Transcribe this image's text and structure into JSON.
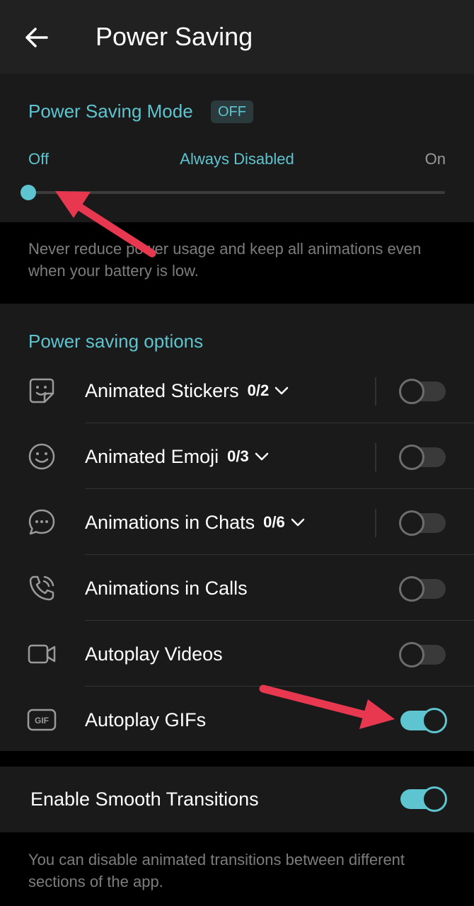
{
  "header": {
    "title": "Power Saving"
  },
  "mode": {
    "title": "Power Saving Mode",
    "badge": "OFF",
    "slider": {
      "left_label": "Off",
      "middle_label": "Always Disabled",
      "right_label": "On",
      "value": 0
    },
    "description": "Never reduce power usage and keep all animations even when your battery is low."
  },
  "options": {
    "title": "Power saving options",
    "items": [
      {
        "label": "Animated Stickers",
        "count": "0/2",
        "icon": "sticker-icon",
        "expandable": true,
        "on": false
      },
      {
        "label": "Animated Emoji",
        "count": "0/3",
        "icon": "emoji-icon",
        "expandable": true,
        "on": false
      },
      {
        "label": "Animations in Chats",
        "count": "0/6",
        "icon": "chat-bubble-icon",
        "expandable": true,
        "on": false
      },
      {
        "label": "Animations in Calls",
        "count": "",
        "icon": "phone-call-icon",
        "expandable": false,
        "on": false
      },
      {
        "label": "Autoplay Videos",
        "count": "",
        "icon": "video-camera-icon",
        "expandable": false,
        "on": false
      },
      {
        "label": "Autoplay GIFs",
        "count": "",
        "icon": "gif-icon",
        "expandable": false,
        "on": true
      }
    ]
  },
  "smooth": {
    "label": "Enable Smooth Transitions",
    "on": true
  },
  "footer": {
    "description": "You can disable animated transitions between different sections of the app."
  },
  "colors": {
    "accent": "#5ec4cf",
    "annotation_arrow": "#e8384f"
  }
}
